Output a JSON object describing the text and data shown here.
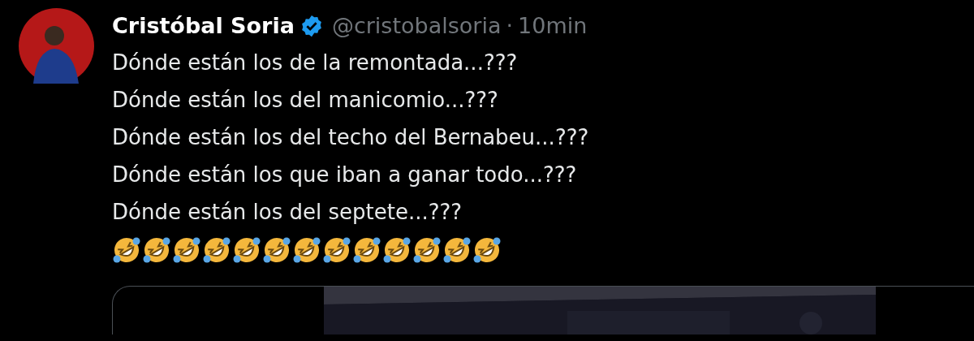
{
  "author": {
    "name": "Cristóbal Soria",
    "verified": true,
    "handle": "@cristobalsoria",
    "separator": "·",
    "time": "10min"
  },
  "lines": [
    "Dónde están los de la remontada...???",
    "Dónde están los del manicomio...???",
    "Dónde están los del techo del Bernabeu...???",
    "Dónde están los que iban a ganar todo...???",
    "Dónde están los del septete...???"
  ],
  "emojis": [
    {
      "kind": "rofl"
    },
    {
      "kind": "rofl"
    },
    {
      "kind": "rofl"
    },
    {
      "kind": "rofl"
    },
    {
      "kind": "rofl"
    },
    {
      "kind": "rofl"
    },
    {
      "kind": "rofl"
    },
    {
      "kind": "rofl"
    },
    {
      "kind": "rofl"
    },
    {
      "kind": "rofl"
    },
    {
      "kind": "rofl"
    },
    {
      "kind": "rofl"
    },
    {
      "kind": "rofl"
    }
  ]
}
